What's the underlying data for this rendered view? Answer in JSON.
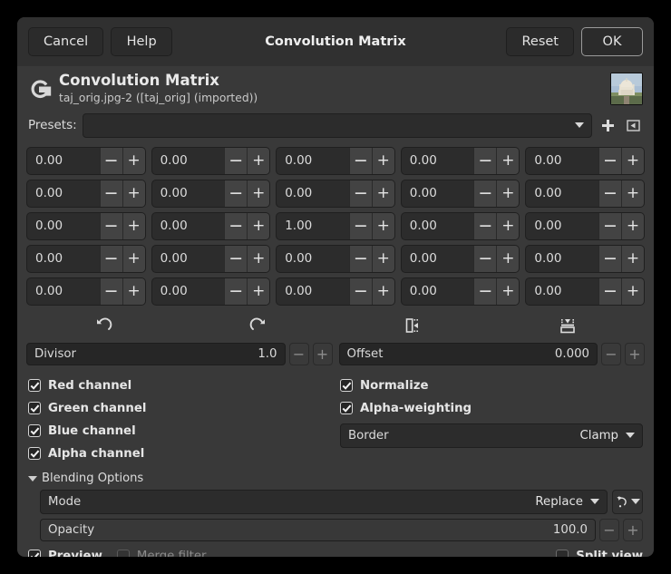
{
  "titlebar": {
    "cancel_label": "Cancel",
    "help_label": "Help",
    "title": "Convolution Matrix",
    "reset_label": "Reset",
    "ok_label": "OK"
  },
  "identity": {
    "logo_icon": "gimp-logo-icon",
    "title": "Convolution Matrix",
    "subtitle": "taj_orig.jpg-2 ([taj_orig] (imported))",
    "thumbnail_icon": "image-thumbnail"
  },
  "presets": {
    "label": "Presets:",
    "value": "",
    "placeholder": "",
    "dropdown_icon": "chevron-down-icon",
    "add_icon": "plus-icon",
    "menu_icon": "preset-menu-icon"
  },
  "matrix": {
    "rows": [
      [
        "0.00",
        "0.00",
        "0.00",
        "0.00",
        "0.00"
      ],
      [
        "0.00",
        "0.00",
        "0.00",
        "0.00",
        "0.00"
      ],
      [
        "0.00",
        "0.00",
        "1.00",
        "0.00",
        "0.00"
      ],
      [
        "0.00",
        "0.00",
        "0.00",
        "0.00",
        "0.00"
      ],
      [
        "0.00",
        "0.00",
        "0.00",
        "0.00",
        "0.00"
      ]
    ],
    "decrement_label": "−",
    "increment_label": "+"
  },
  "transforms": [
    {
      "name": "rotate-left-icon",
      "tooltip": "Rotate left"
    },
    {
      "name": "rotate-right-icon",
      "tooltip": "Rotate right"
    },
    {
      "name": "flip-horizontal-icon",
      "tooltip": "Flip horizontally"
    },
    {
      "name": "flip-vertical-icon",
      "tooltip": "Flip vertically"
    }
  ],
  "divisor": {
    "label": "Divisor",
    "value": "1.0",
    "fill_percent": 0
  },
  "offset": {
    "label": "Offset",
    "value": "0.000",
    "fill_percent": 0
  },
  "channels": [
    {
      "label": "Red channel",
      "checked": true
    },
    {
      "label": "Green channel",
      "checked": true
    },
    {
      "label": "Blue channel",
      "checked": true
    },
    {
      "label": "Alpha channel",
      "checked": true
    }
  ],
  "right_options": [
    {
      "label": "Normalize",
      "checked": true
    },
    {
      "label": "Alpha-weighting",
      "checked": true
    }
  ],
  "border": {
    "label": "Border",
    "value": "Clamp"
  },
  "blending": {
    "expander_label": "Blending Options",
    "expanded": true,
    "mode": {
      "label": "Mode",
      "value": "Replace"
    },
    "reset_icon": "reset-dropdown-icon",
    "opacity": {
      "label": "Opacity",
      "value": "100.0",
      "fill_percent": 100
    }
  },
  "footer": {
    "preview": {
      "label": "Preview",
      "checked": true
    },
    "merge_filter": {
      "label": "Merge filter",
      "checked": false,
      "disabled": true
    },
    "split_view": {
      "label": "Split view",
      "checked": false
    }
  },
  "colors": {
    "dialog_bg": "#393939",
    "titlebar_bg": "#303030",
    "field_bg": "#2c2c2c",
    "text": "#e3e3e3",
    "accent_border": "#9a9a9a"
  }
}
